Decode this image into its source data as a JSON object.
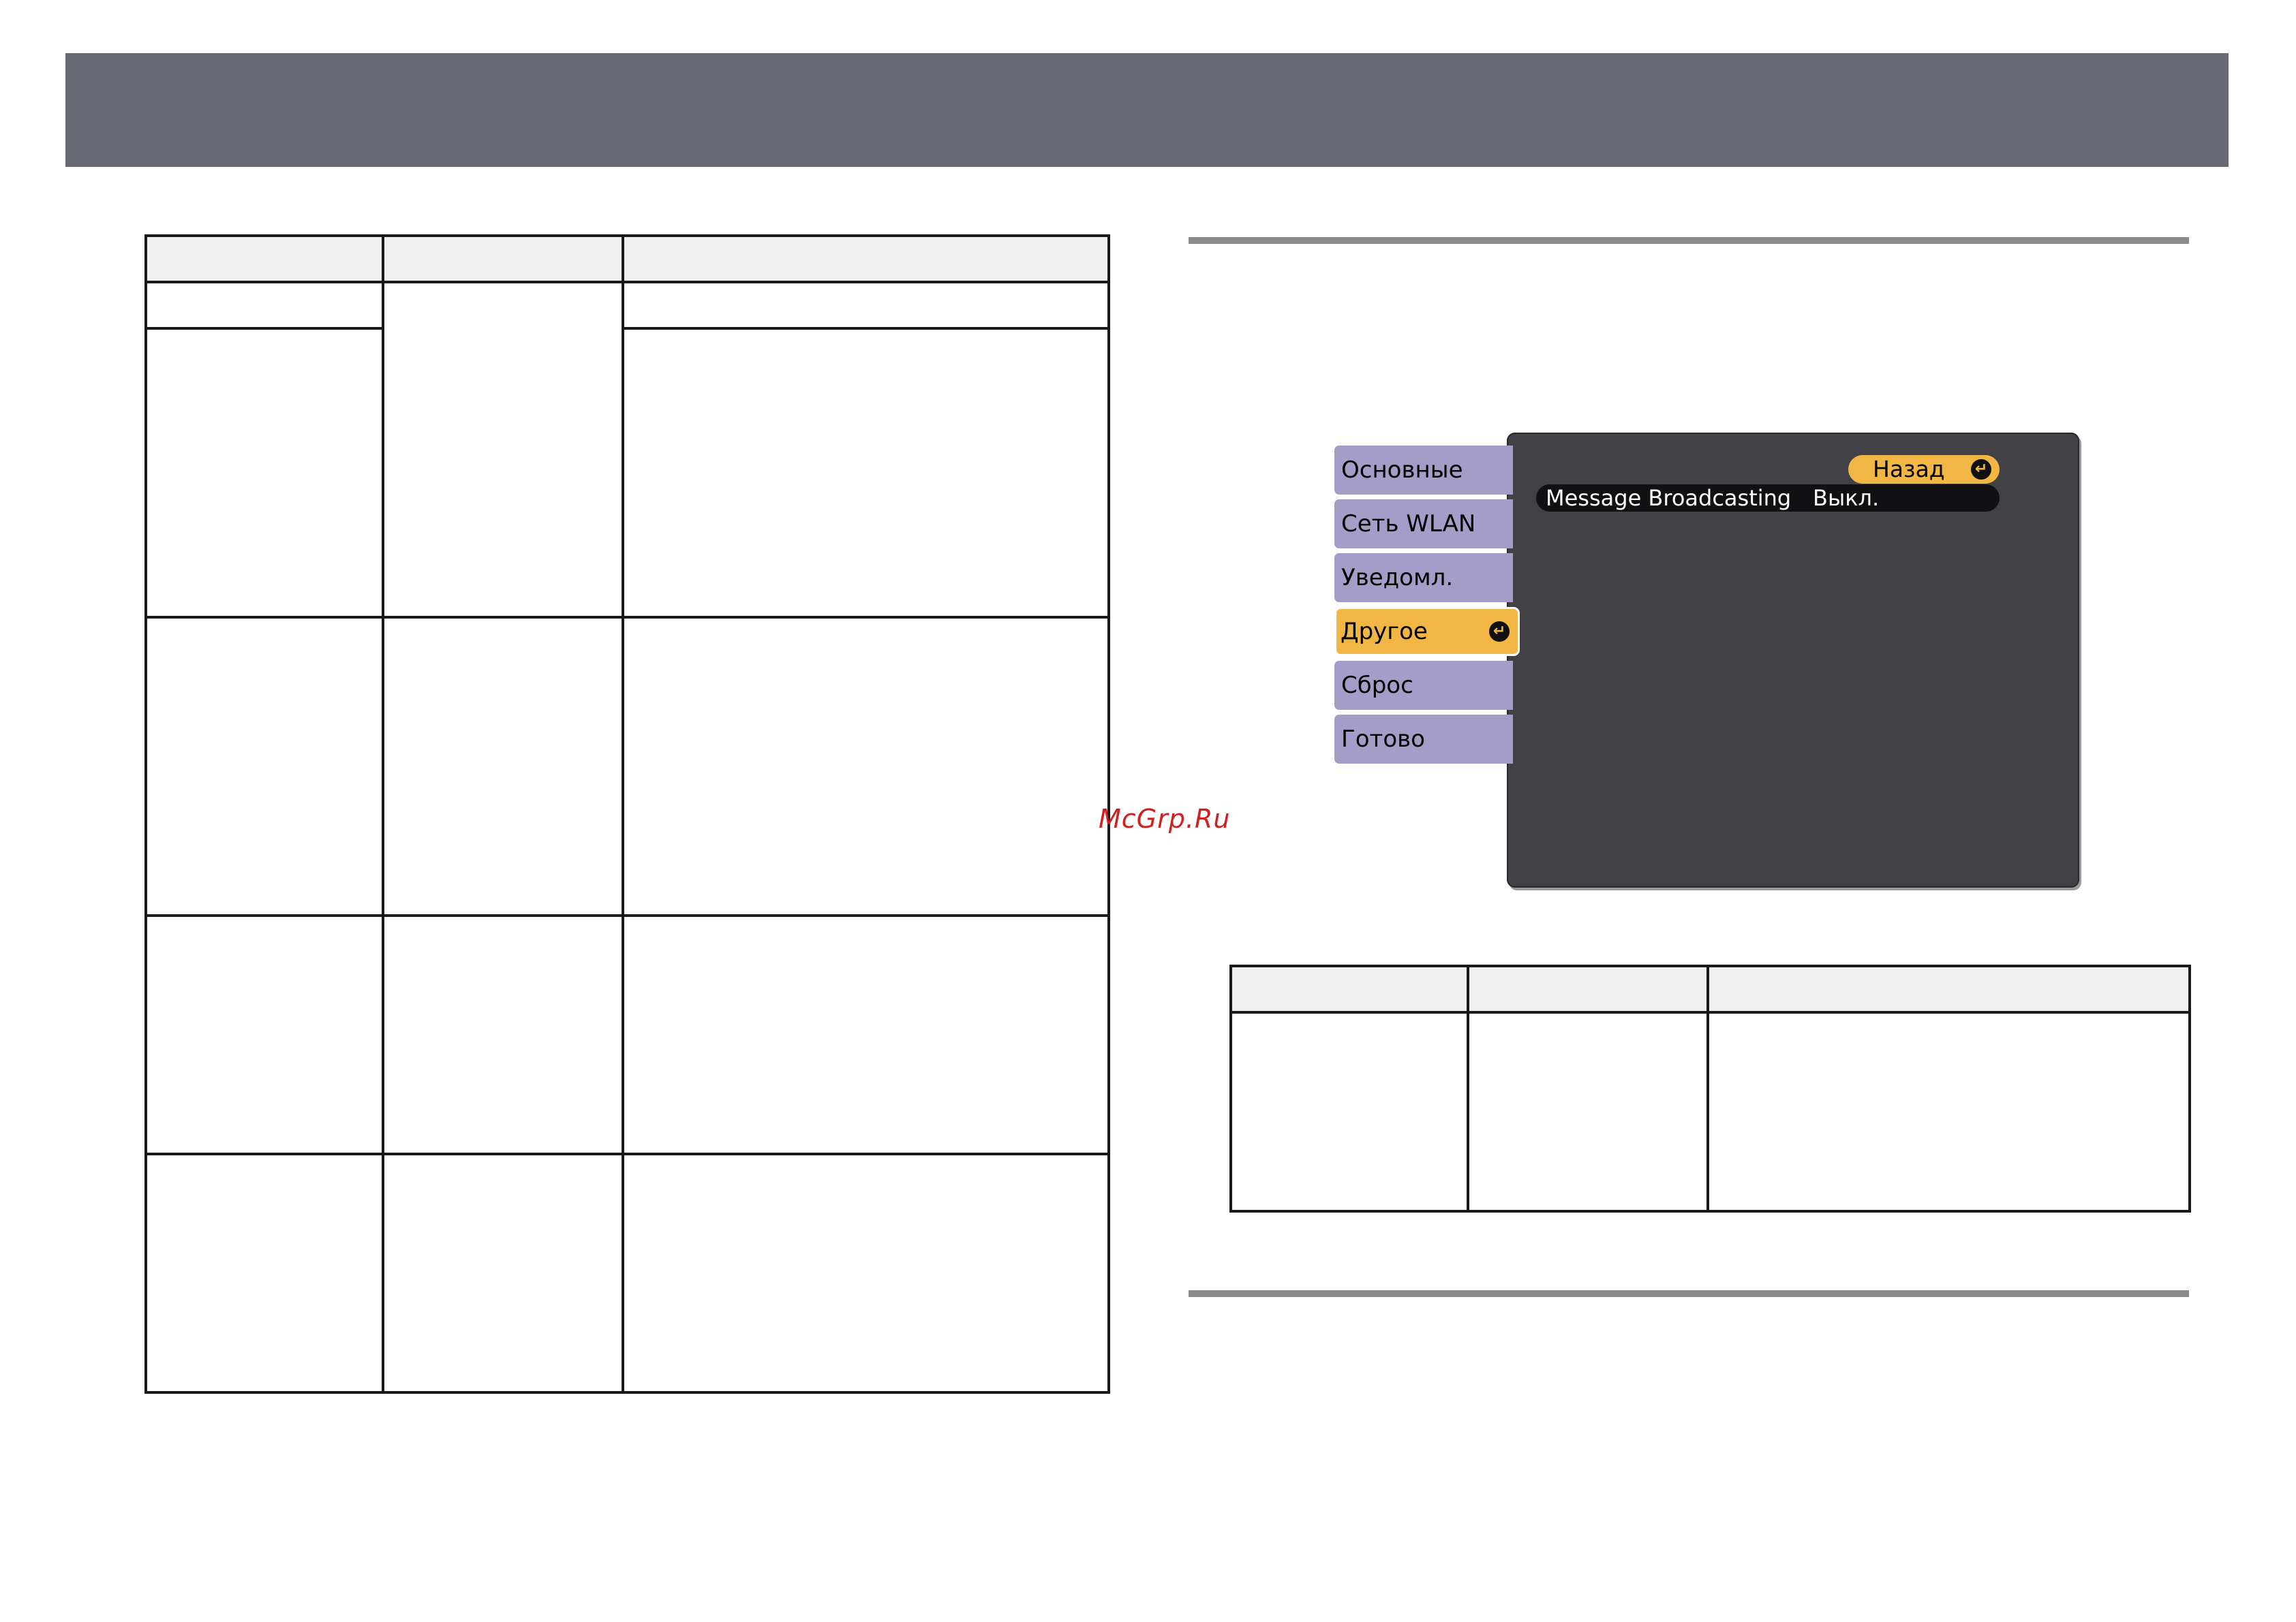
{
  "osd": {
    "tabs": [
      {
        "label": "Основные"
      },
      {
        "label": "Сеть WLAN"
      },
      {
        "label": "Уведомл."
      },
      {
        "label": "Другое"
      },
      {
        "label": "Сброс"
      },
      {
        "label": "Готово"
      }
    ],
    "back_label": "Назад",
    "setting": {
      "name": "Message Broadcasting",
      "value": "Выкл."
    }
  },
  "watermark": "McGrp.Ru",
  "colors": {
    "header": "#676a73",
    "tab": "#a49dc8",
    "tab_active": "#f2b644",
    "osd_panel": "#414146",
    "watermark": "#d02020"
  }
}
